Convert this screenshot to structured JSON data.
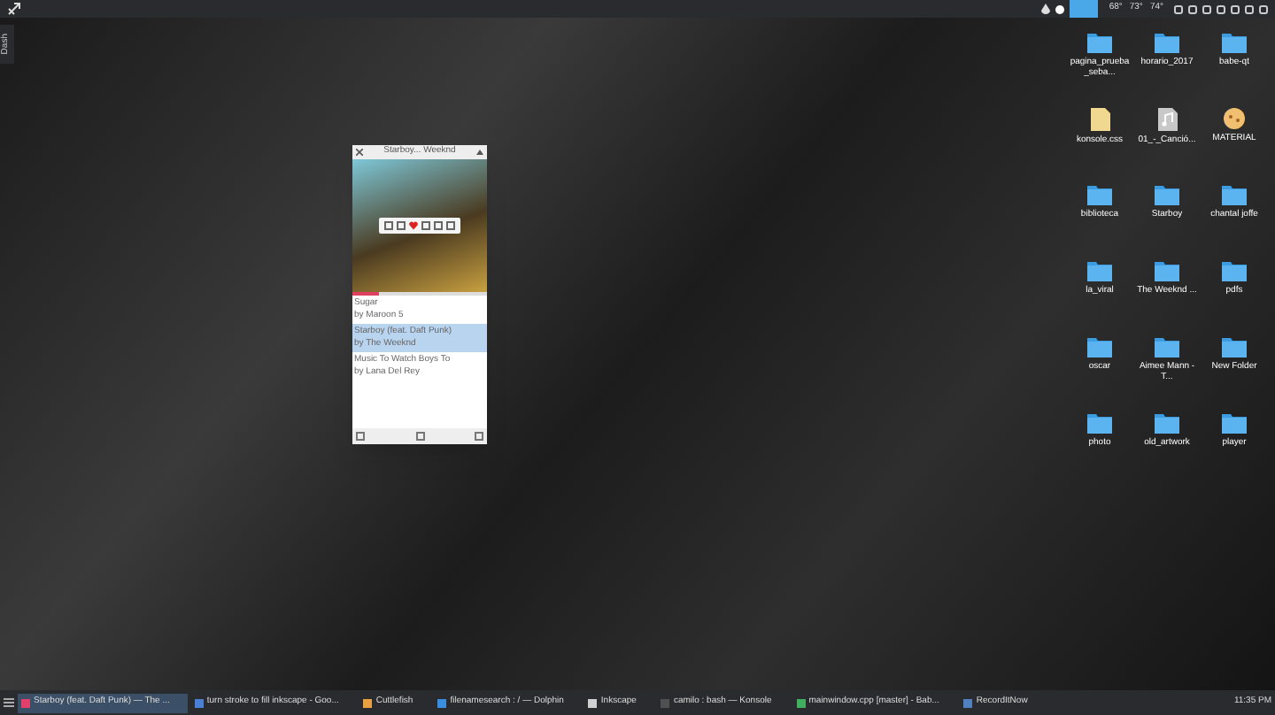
{
  "top_panel": {
    "side_tab": "Dash",
    "temperatures": [
      "68°",
      "73°",
      "74°"
    ]
  },
  "player": {
    "title": "Starboy... Weeknd",
    "progress": {
      "level": 0.2
    },
    "playlist": [
      {
        "title": "Sugar",
        "artist": "by Maroon 5",
        "selected": false
      },
      {
        "title": "Starboy (feat. Daft Punk)",
        "artist": "by The Weeknd",
        "selected": true
      },
      {
        "title": "Music To Watch Boys To",
        "artist": "by Lana Del Rey",
        "selected": false
      }
    ]
  },
  "desktop_icons": [
    {
      "label": "pagina_prueba_seba...",
      "kind": "folder"
    },
    {
      "label": "horario_2017",
      "kind": "folder"
    },
    {
      "label": "babe-qt",
      "kind": "folder"
    },
    {
      "label": "konsole.css",
      "kind": "file"
    },
    {
      "label": "01_-_Canció...",
      "kind": "audio"
    },
    {
      "label": "MATERIAL",
      "kind": "image"
    },
    {
      "label": "biblioteca",
      "kind": "folder"
    },
    {
      "label": "Starboy",
      "kind": "folder"
    },
    {
      "label": "chantal joffe",
      "kind": "folder"
    },
    {
      "label": "la_viral",
      "kind": "folder"
    },
    {
      "label": "The Weeknd ...",
      "kind": "folder"
    },
    {
      "label": "pdfs",
      "kind": "folder"
    },
    {
      "label": "oscar",
      "kind": "folder"
    },
    {
      "label": "Aimee Mann - T...",
      "kind": "folder"
    },
    {
      "label": "New Folder",
      "kind": "folder"
    },
    {
      "label": "photo",
      "kind": "folder"
    },
    {
      "label": "old_artwork",
      "kind": "folder"
    },
    {
      "label": "player",
      "kind": "folder"
    }
  ],
  "taskbar": {
    "tasks": [
      {
        "label": "Starboy (feat. Daft Punk) — The ...",
        "selected": true,
        "color": "#e0406a"
      },
      {
        "label": "turn stroke to fill inkscape - Goo...",
        "selected": false,
        "color": "#4a7fd8"
      },
      {
        "label": "Cuttlefish",
        "selected": false,
        "color": "#e8a040"
      },
      {
        "label": "filenamesearch : / — Dolphin",
        "selected": false,
        "color": "#3a8ee0"
      },
      {
        "label": "Inkscape",
        "selected": false,
        "color": "#d0d0d0"
      },
      {
        "label": "camilo : bash — Konsole",
        "selected": false,
        "color": "#505050"
      },
      {
        "label": "mainwindow.cpp [master] - Bab...",
        "selected": false,
        "color": "#40b060"
      },
      {
        "label": "RecordItNow",
        "selected": false,
        "color": "#5080c0"
      }
    ],
    "clock": "11:35 PM"
  }
}
